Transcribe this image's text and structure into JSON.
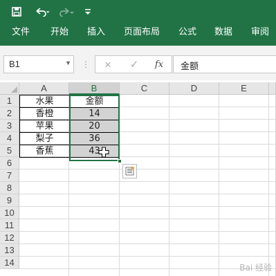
{
  "ribbon": {
    "colors": {
      "brand": "#217346",
      "selection": "#d3d3d3"
    },
    "menu": [
      "文件",
      "开始",
      "插入",
      "页面布局",
      "公式",
      "数据",
      "审阅"
    ]
  },
  "formula_bar": {
    "name_box": "B1",
    "cancel_icon": "×",
    "enter_icon": "✓",
    "fx_label": "fx",
    "value": "金额"
  },
  "sheet": {
    "columns": [
      "A",
      "B",
      "C",
      "D",
      "E"
    ],
    "rows": [
      "1",
      "2",
      "3",
      "4",
      "5",
      "6",
      "7",
      "8",
      "9",
      "10",
      "11",
      "12",
      "13",
      "14"
    ],
    "data": [
      [
        "水果",
        "金额"
      ],
      [
        "香橙",
        "14"
      ],
      [
        "苹果",
        "20"
      ],
      [
        "梨子",
        "36"
      ],
      [
        "香蕉",
        "43"
      ]
    ]
  },
  "watermark": "Bai 经验"
}
